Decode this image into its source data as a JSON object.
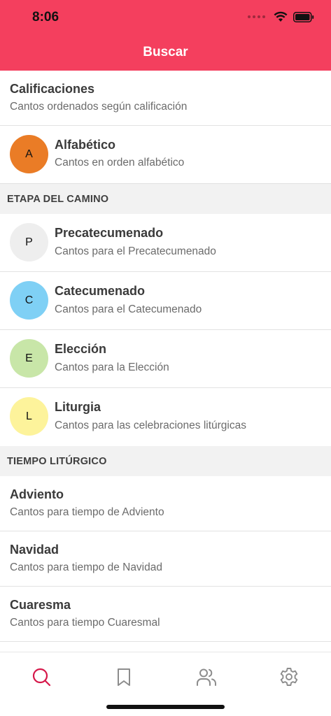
{
  "status": {
    "time": "8:06"
  },
  "header": {
    "title": "Buscar"
  },
  "top_items": [
    {
      "title": "Calificaciones",
      "subtitle": "Cantos ordenados según calificación"
    },
    {
      "avatar": "A",
      "title": "Alfabético",
      "subtitle": "Cantos en orden alfabético",
      "color": "#ea7c26"
    }
  ],
  "section_stage": {
    "label": "ETAPA DEL CAMINO"
  },
  "stage_items": [
    {
      "avatar": "P",
      "title": "Precatecumenado",
      "subtitle": "Cantos para el Precatecumenado",
      "color": "#eeeeee"
    },
    {
      "avatar": "C",
      "title": "Catecumenado",
      "subtitle": "Cantos para el Catecumenado",
      "color": "#7fd0f5"
    },
    {
      "avatar": "E",
      "title": "Elección",
      "subtitle": "Cantos para la Elección",
      "color": "#c8e6a8"
    },
    {
      "avatar": "L",
      "title": "Liturgia",
      "subtitle": "Cantos para las celebraciones litúrgicas",
      "color": "#fdf39b"
    }
  ],
  "section_time": {
    "label": "TIEMPO LITÚRGICO"
  },
  "time_items": [
    {
      "title": "Adviento",
      "subtitle": "Cantos para tiempo de Adviento"
    },
    {
      "title": "Navidad",
      "subtitle": "Cantos para tiempo de Navidad"
    },
    {
      "title": "Cuaresma",
      "subtitle": "Cantos para tiempo Cuaresmal"
    }
  ],
  "tabbar": {
    "tabs": [
      {
        "icon": "search-icon",
        "active": true
      },
      {
        "icon": "bookmark-icon",
        "active": false
      },
      {
        "icon": "users-icon",
        "active": false
      },
      {
        "icon": "gear-icon",
        "active": false
      }
    ],
    "active_color": "#d6184a",
    "inactive_color": "#8c8c8c"
  }
}
